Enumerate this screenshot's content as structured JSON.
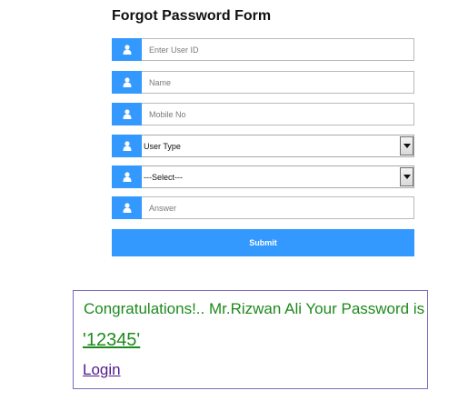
{
  "form": {
    "title": "Forgot Password Form",
    "fields": [
      {
        "placeholder": "Enter User ID",
        "icon": "user-icon"
      },
      {
        "placeholder": "Name",
        "icon": "user-icon"
      },
      {
        "placeholder": "Mobile No",
        "icon": "user-icon"
      },
      {
        "selected": "User Type",
        "icon": "user-icon"
      },
      {
        "selected": "---Select---",
        "icon": "user-icon"
      },
      {
        "placeholder": "Answer",
        "icon": "user-icon"
      }
    ],
    "submit_label": "Submit"
  },
  "message": {
    "congrats_text": "Congratulations!.. Mr.Rizwan Ali Your Password is",
    "password": "'12345'",
    "login_label": "Login"
  },
  "colors": {
    "accent": "#3399ff",
    "success_text": "#1d8a1d",
    "link_visited": "#551a8b",
    "message_border": "#7a6bbd"
  }
}
